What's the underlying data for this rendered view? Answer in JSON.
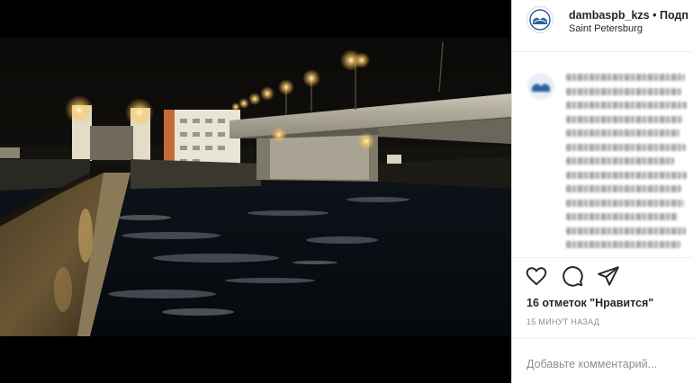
{
  "post": {
    "username": "dambaspb_kzs",
    "separator": "•",
    "follow_label": "Подп",
    "location": "Saint Petersburg"
  },
  "actions": {
    "like_icon": "heart-icon",
    "comment_icon": "comment-icon",
    "share_icon": "share-icon"
  },
  "likes_text": "16 отметок \"Нравится\"",
  "timestamp": "15 МИНУТ НАЗАД",
  "comment": {
    "placeholder": "Добавьте комментарий..."
  },
  "colors": {
    "text": "#262626",
    "secondary": "#8e8e8e",
    "border": "#dbdbdb",
    "avatar_blue": "#2a5f9e"
  }
}
